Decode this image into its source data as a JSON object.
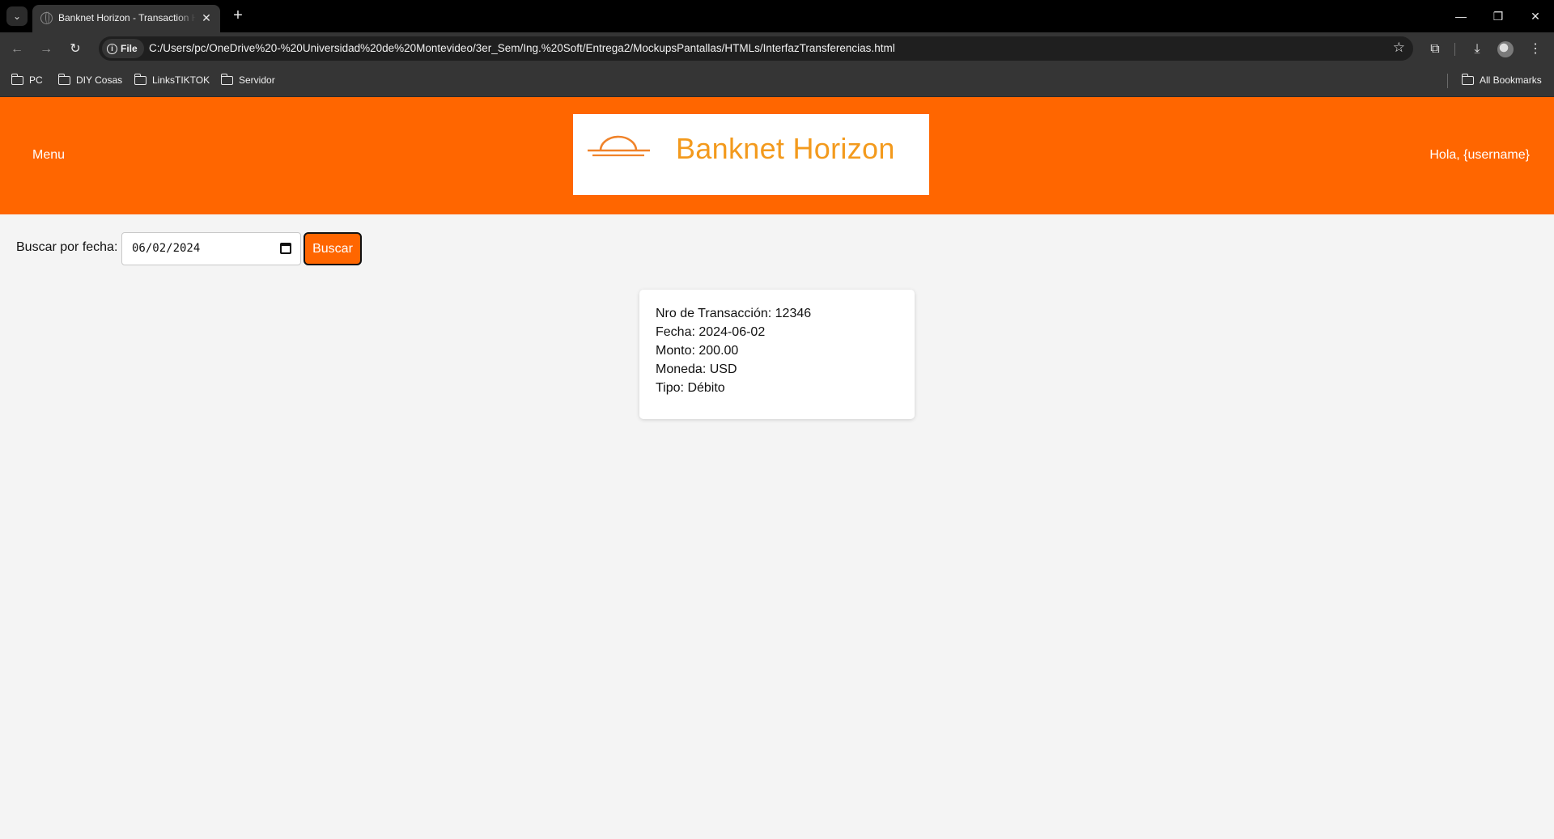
{
  "browser": {
    "tab_title": "Banknet Horizon - Transaction H",
    "new_tab_symbol": "+",
    "site_chip_label": "File",
    "url": "C:/Users/pc/OneDrive%20-%20Universidad%20de%20Montevideo/3er_Sem/Ing.%20Soft/Entrega2/MockupsPantallas/HTMLs/InterfazTransferencias.html",
    "bookmarks": [
      "PC",
      "DIY Cosas",
      "LinksTIKTOK",
      "Servidor"
    ],
    "all_bookmarks_label": "All Bookmarks"
  },
  "header": {
    "menu_label": "Menu",
    "brand_name": "Banknet Horizon",
    "greeting": "Hola, {username}",
    "background_color": "#ff6600",
    "brand_color": "#f39a1d"
  },
  "search": {
    "label": "Buscar por fecha:",
    "date_value": "06/02/2024",
    "button_label": "Buscar"
  },
  "transaction": {
    "number_label": "Nro de Transacción:",
    "number": "12346",
    "date_label": "Fecha:",
    "date": "2024-06-02",
    "amount_label": "Monto:",
    "amount": "200.00",
    "currency_label": "Moneda:",
    "currency": "USD",
    "type_label": "Tipo:",
    "type": "Débito"
  },
  "icons": {
    "tab_list": "chevron-down-icon",
    "favicon": "globe-icon",
    "back": "arrow-left-icon",
    "forward": "arrow-right-icon",
    "reload": "reload-icon",
    "bookmark_star": "star-icon",
    "extensions": "puzzle-icon",
    "downloads": "download-icon",
    "calendar": "calendar-icon",
    "logo": "sunrise-icon"
  }
}
